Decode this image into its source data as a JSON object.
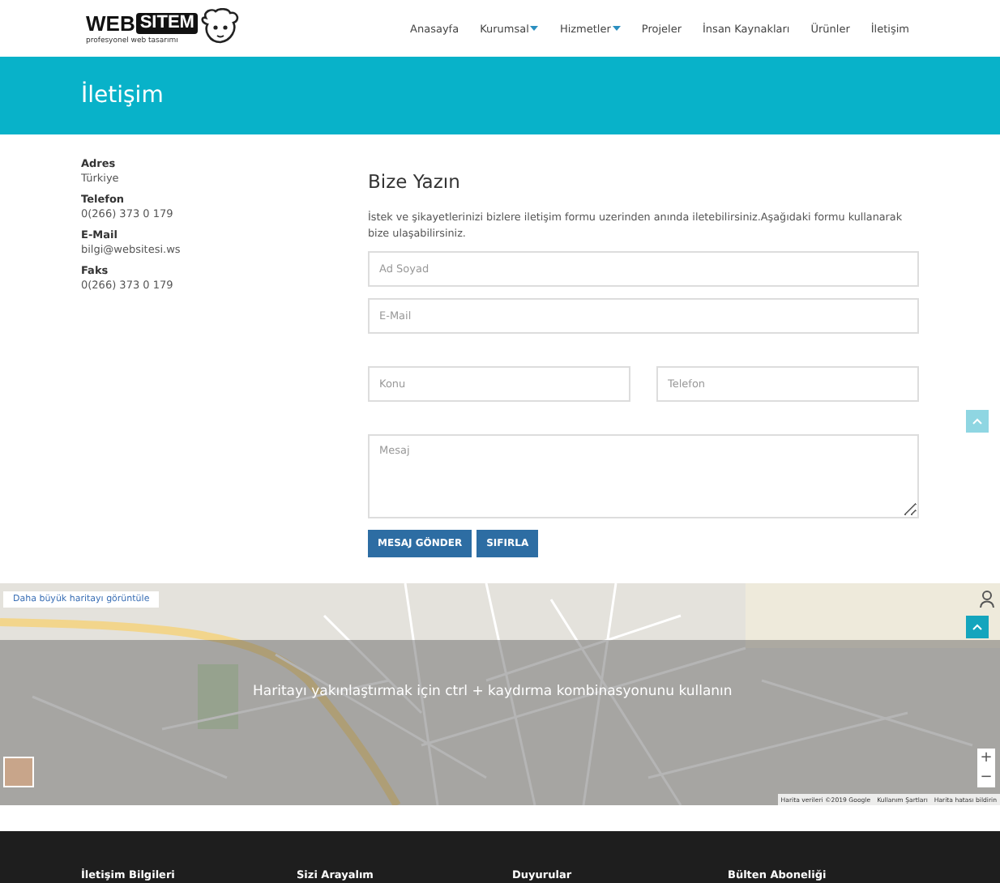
{
  "header": {
    "logo": {
      "word": "WEB",
      "boxed_word": "SITEM",
      "tagline": "profesyonel web tasarımı"
    },
    "nav": [
      {
        "label": "Anasayfa",
        "dropdown": false
      },
      {
        "label": "Kurumsal",
        "dropdown": true
      },
      {
        "label": "Hizmetler",
        "dropdown": true
      },
      {
        "label": "Projeler",
        "dropdown": false
      },
      {
        "label": "İnsan Kaynakları",
        "dropdown": false
      },
      {
        "label": "Ürünler",
        "dropdown": false
      },
      {
        "label": "İletişim",
        "dropdown": false
      }
    ]
  },
  "page_title": "İletişim",
  "contact_info": [
    {
      "label": "Adres",
      "value": "Türkiye"
    },
    {
      "label": "Telefon",
      "value": "0(266) 373 0 179"
    },
    {
      "label": "E-Mail",
      "value": "bilgi@websitesi.ws"
    },
    {
      "label": "Faks",
      "value": "0(266) 373 0 179"
    }
  ],
  "form": {
    "title": "Bize Yazın",
    "intro": "İstek ve şikayetlerinizi bizlere iletişim formu uzerinden anında iletebilirsiniz.Aşağıdaki formu kullanarak bize ulaşabilirsiniz.",
    "fields": [
      {
        "kind": "full",
        "placeholder": "Ad Soyad"
      },
      {
        "kind": "full",
        "placeholder": "E-Mail"
      },
      {
        "kind": "half",
        "placeholder": "Konu"
      },
      {
        "kind": "half",
        "placeholder": "Telefon"
      },
      {
        "kind": "textarea",
        "placeholder": "Mesaj"
      }
    ],
    "buttons": [
      "MESAJ GÖNDER",
      "SIFIRLA"
    ]
  },
  "map": {
    "link": "Daha büyük haritayı görüntüle",
    "overlay_message": "Haritayı yakınlaştırmak için ctrl + kaydırma kombinasyonunu kullanın",
    "zoom_in": "+",
    "zoom_out": "−",
    "attribution": [
      "Harita verileri ©2019 Google",
      "Kullanım Şartları",
      "Harita hatası bildirin"
    ]
  },
  "footer": {
    "headings": [
      "İletişim Bilgileri",
      "Sizi Arayalım",
      "Duyurular",
      "Bülten Aboneliği"
    ]
  }
}
